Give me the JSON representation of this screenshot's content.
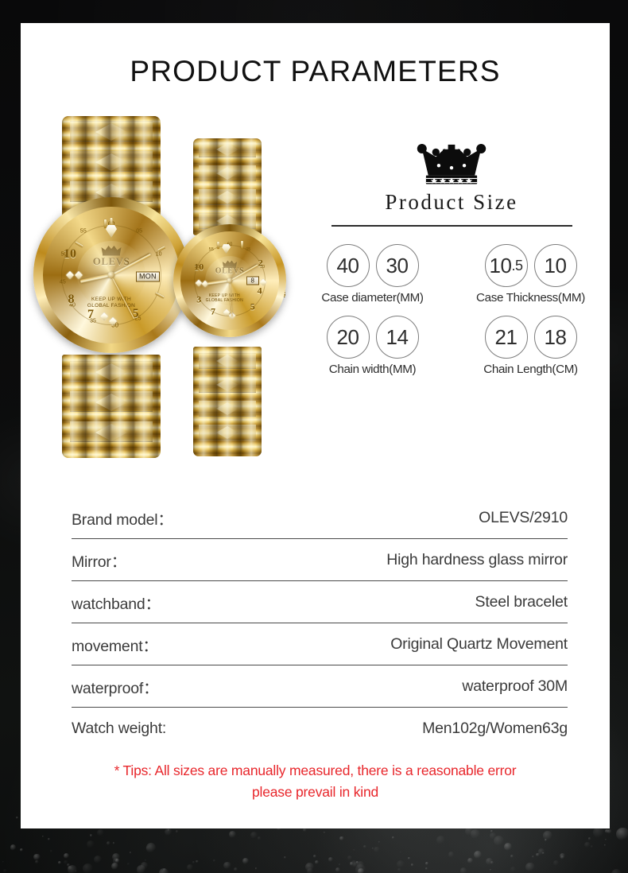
{
  "page": {
    "title": "PRODUCT PARAMETERS",
    "card_bg": "#ffffff",
    "backdrop_color": "#0a0a0b"
  },
  "product_size": {
    "crown_icon": "crown-icon",
    "heading": "Product Size",
    "rows": [
      {
        "groups": [
          {
            "values": [
              "40",
              "30"
            ],
            "label": "Case diameter(MM)"
          },
          {
            "values": [
              "10.5",
              "10"
            ],
            "label": "Case Thickness(MM)"
          }
        ]
      },
      {
        "groups": [
          {
            "values": [
              "20",
              "14"
            ],
            "label": "Chain width(MM)"
          },
          {
            "values": [
              "21",
              "18"
            ],
            "label": "Chain Length(CM)"
          }
        ]
      }
    ]
  },
  "specs": [
    {
      "key": "Brand model：",
      "value": "OLEVS/2910"
    },
    {
      "key": "Mirror：",
      "value": "High hardness glass mirror"
    },
    {
      "key": "watchband：",
      "value": "Steel bracelet"
    },
    {
      "key": "movement：",
      "value": "Original Quartz Movement"
    },
    {
      "key": "waterproof：",
      "value": "waterproof 30M"
    },
    {
      "key": "Watch weight:",
      "value": "Men102g/Women63g"
    }
  ],
  "tips": {
    "color": "#e8262b",
    "line1": "* Tips: All sizes are manually measured, there is a reasonable error",
    "line2": "please prevail in kind"
  },
  "watches": {
    "mens": {
      "brand": "OLEVS",
      "slogan_line1": "KEEP UP WITH",
      "slogan_line2": "GLOBAL FASHION",
      "day_window": "MON",
      "numerals": [
        "10",
        "8",
        "7",
        "5"
      ],
      "minute_marks": [
        "60",
        "55",
        "05",
        "50",
        "10",
        "45",
        "40",
        "35",
        "30",
        "25"
      ]
    },
    "womens": {
      "brand": "OLEVS",
      "slogan_line1": "KEEP UP WITH",
      "slogan_line2": "GLOBAL FASHION",
      "day_window": "8",
      "numerals": [
        "10",
        "2",
        "3",
        "4",
        "5",
        "7"
      ],
      "minute_marks": [
        "60",
        "55",
        "05",
        "50",
        "10",
        "30"
      ]
    }
  }
}
